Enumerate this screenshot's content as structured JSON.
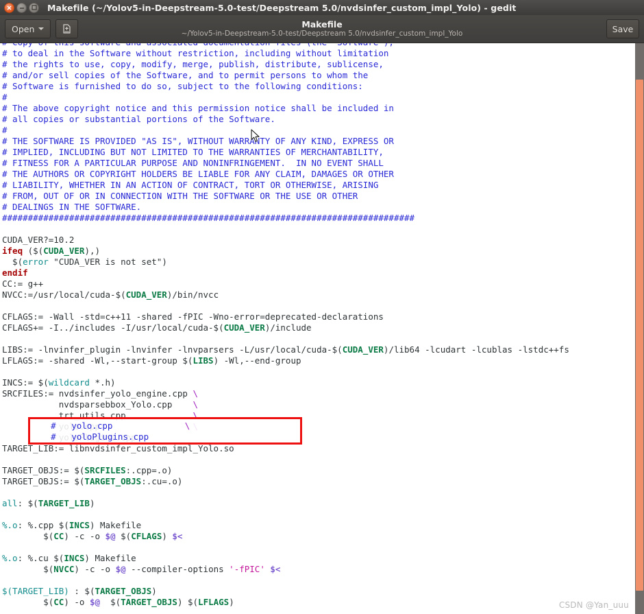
{
  "window": {
    "title": "Makefile (~/Yolov5-in-Deepstream-5.0-test/Deepstream 5.0/nvdsinfer_custom_impl_Yolo) - gedit",
    "controls": {
      "close": "×",
      "minimize": "−",
      "maximize": "□"
    }
  },
  "toolbar": {
    "open_label": "Open",
    "new_doc_icon": "new-document-icon",
    "save_label": "Save",
    "doc_title": "Makefile",
    "doc_subtitle": "~/Yolov5-in-Deepstream-5.0-test/Deepstream 5.0/nvdsinfer_custom_impl_Yolo"
  },
  "annotation": {
    "line1": "    #   yolo.cpp              \\",
    "line2": "    #   yoloPlugins.cpp",
    "box_color": "#ee1111"
  },
  "watermark": {
    "text": "CSDN @Yan_uuu"
  },
  "scrollbar": {
    "thumb_color": "#f0906a",
    "track_color": "#6f6c69"
  },
  "editor": {
    "language": "makefile",
    "colors": {
      "comment": "#2929d6",
      "keyword": "#a40000",
      "function": "#128c8c",
      "variable": "#0a7a45",
      "target": "#128c8c",
      "automatic_variable": "#7b5ad0",
      "continuation": "#a020c0",
      "string": "#c4149c",
      "text": "#2e3436",
      "background": "#ffffff"
    },
    "lines": [
      "# Copy of this software and associated documentation files (the \"Software\"),",
      "# to deal in the Software without restriction, including without limitation",
      "# the rights to use, copy, modify, merge, publish, distribute, sublicense,",
      "# and/or sell copies of the Software, and to permit persons to whom the",
      "# Software is furnished to do so, subject to the following conditions:",
      "#",
      "# The above copyright notice and this permission notice shall be included in",
      "# all copies or substantial portions of the Software.",
      "#",
      "# THE SOFTWARE IS PROVIDED \"AS IS\", WITHOUT WARRANTY OF ANY KIND, EXPRESS OR",
      "# IMPLIED, INCLUDING BUT NOT LIMITED TO THE WARRANTIES OF MERCHANTABILITY,",
      "# FITNESS FOR A PARTICULAR PURPOSE AND NONINFRINGEMENT.  IN NO EVENT SHALL",
      "# THE AUTHORS OR COPYRIGHT HOLDERS BE LIABLE FOR ANY CLAIM, DAMAGES OR OTHER",
      "# LIABILITY, WHETHER IN AN ACTION OF CONTRACT, TORT OR OTHERWISE, ARISING",
      "# FROM, OUT OF OR IN CONNECTION WITH THE SOFTWARE OR THE USE OR OTHER",
      "# DEALINGS IN THE SOFTWARE.",
      "################################################################################",
      "",
      "CUDA_VER?=10.2",
      "ifeq ($(CUDA_VER),)",
      "  $(error \"CUDA_VER is not set\")",
      "endif",
      "CC:= g++",
      "NVCC:=/usr/local/cuda-$(CUDA_VER)/bin/nvcc",
      "",
      "CFLAGS:= -Wall -std=c++11 -shared -fPIC -Wno-error=deprecated-declarations",
      "CFLAGS+= -I../includes -I/usr/local/cuda-$(CUDA_VER)/include",
      "",
      "LIBS:= -lnvinfer_plugin -lnvinfer -lnvparsers -L/usr/local/cuda-$(CUDA_VER)/lib64 -lcudart -lcublas -lstdc++fs",
      "LFLAGS:= -shared -Wl,--start-group $(LIBS) -Wl,--end-group",
      "",
      "INCS:= $(wildcard *.h)",
      "SRCFILES:= nvdsinfer_yolo_engine.cpp \\",
      "           nvdsparsebbox_Yolo.cpp    \\",
      "           trt_utils.cpp             \\",
      "           yolo.cpp                  \\",
      "           yoloPlugins.cpp",
      "TARGET_LIB:= libnvdsinfer_custom_impl_Yolo.so",
      "",
      "TARGET_OBJS:= $(SRCFILES:.cpp=.o)",
      "TARGET_OBJS:= $(TARGET_OBJS:.cu=.o)",
      "",
      "all: $(TARGET_LIB)",
      "",
      "%.o: %.cpp $(INCS) Makefile",
      "        $(CC) -c -o $@ $(CFLAGS) $<",
      "",
      "%.o: %.cu $(INCS) Makefile",
      "        $(NVCC) -c -o $@ --compiler-options '-fPIC' $<",
      "",
      "$(TARGET_LIB) : $(TARGET_OBJS)",
      "        $(CC) -o $@  $(TARGET_OBJS) $(LFLAGS)"
    ]
  }
}
